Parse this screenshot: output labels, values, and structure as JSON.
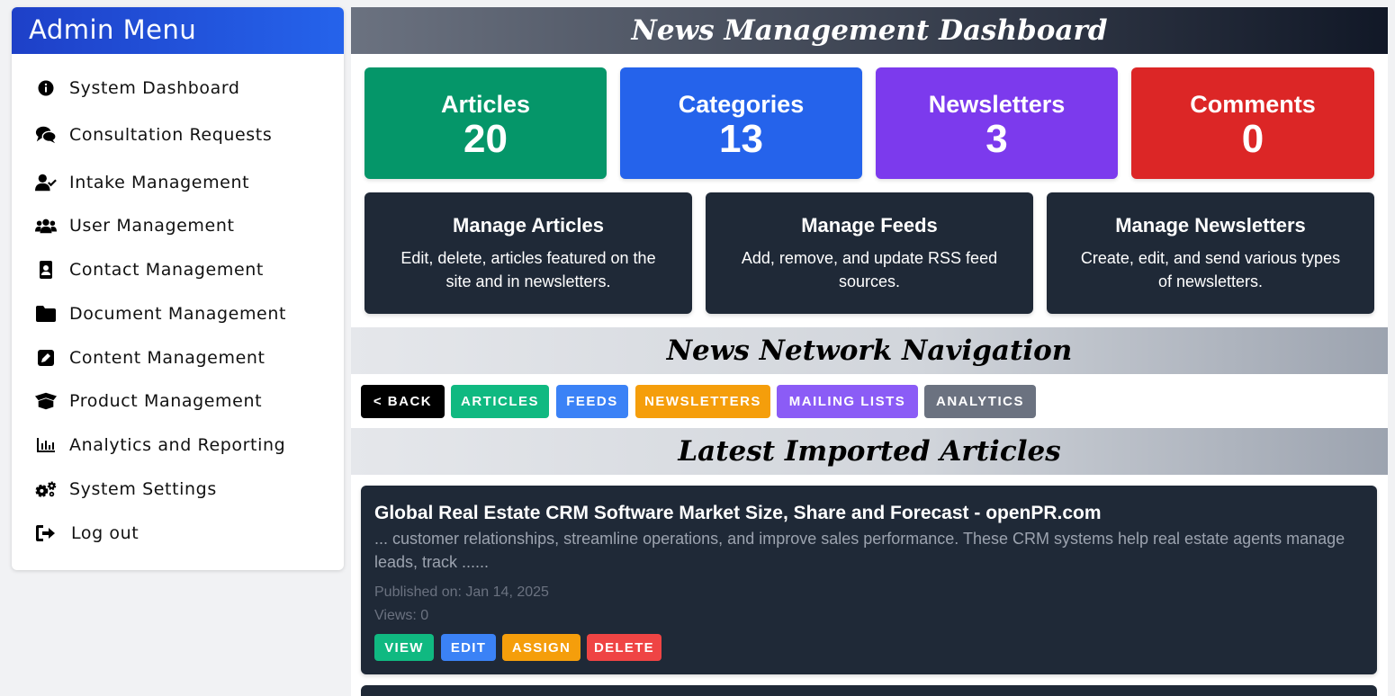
{
  "sidebar": {
    "title": "Admin Menu",
    "items": [
      {
        "label": "System Dashboard",
        "icon": "info-circle-icon"
      },
      {
        "label": "Consultation Requests",
        "icon": "comments-icon"
      },
      {
        "label": "Intake Management",
        "icon": "user-check-icon"
      },
      {
        "label": "User Management",
        "icon": "users-icon"
      },
      {
        "label": "Contact Management",
        "icon": "address-book-icon"
      },
      {
        "label": "Document Management",
        "icon": "folder-icon"
      },
      {
        "label": "Content Management",
        "icon": "edit-icon"
      },
      {
        "label": "Product Management",
        "icon": "box-open-icon"
      },
      {
        "label": "Analytics and Reporting",
        "icon": "chart-bar-icon"
      },
      {
        "label": "System Settings",
        "icon": "cogs-icon"
      },
      {
        "label": "Log out",
        "icon": "sign-out-icon"
      }
    ]
  },
  "main": {
    "title": "News Management Dashboard",
    "stats": [
      {
        "label": "Articles",
        "value": "20",
        "color": "#059669"
      },
      {
        "label": "Categories",
        "value": "13",
        "color": "#2563eb"
      },
      {
        "label": "Newsletters",
        "value": "3",
        "color": "#7c3aed"
      },
      {
        "label": "Comments",
        "value": "0",
        "color": "#dc2626"
      }
    ],
    "cards": [
      {
        "title": "Manage Articles",
        "desc": "Edit, delete, articles featured on the site and in newsletters."
      },
      {
        "title": "Manage Feeds",
        "desc": "Add, remove, and update RSS feed sources."
      },
      {
        "title": "Manage Newsletters",
        "desc": "Create, edit, and send various types of newsletters."
      }
    ],
    "nav_title": "News Network Navigation",
    "nav": [
      {
        "label": "< Back",
        "color": "#000000"
      },
      {
        "label": "Articles",
        "color": "#10b981"
      },
      {
        "label": "Feeds",
        "color": "#3b82f6"
      },
      {
        "label": "Newsletters",
        "color": "#f59e0b"
      },
      {
        "label": "Mailing Lists",
        "color": "#8b5cf6"
      },
      {
        "label": "Analytics",
        "color": "#6b7280"
      }
    ],
    "latest_title": "Latest Imported Articles",
    "article": {
      "title": "Global Real Estate CRM Software Market Size, Share and Forecast - openPR.com",
      "summary": "... customer relationships, streamline operations, and improve sales performance. These CRM systems help real estate agents manage leads, track ......",
      "published": "Published on: Jan 14, 2025",
      "views": "Views: 0",
      "actions": [
        {
          "label": "VIEW",
          "color": "#10b981"
        },
        {
          "label": "EDIT",
          "color": "#3b82f6"
        },
        {
          "label": "ASSIGN",
          "color": "#f59e0b"
        },
        {
          "label": "DELETE",
          "color": "#ef4444"
        }
      ]
    }
  }
}
